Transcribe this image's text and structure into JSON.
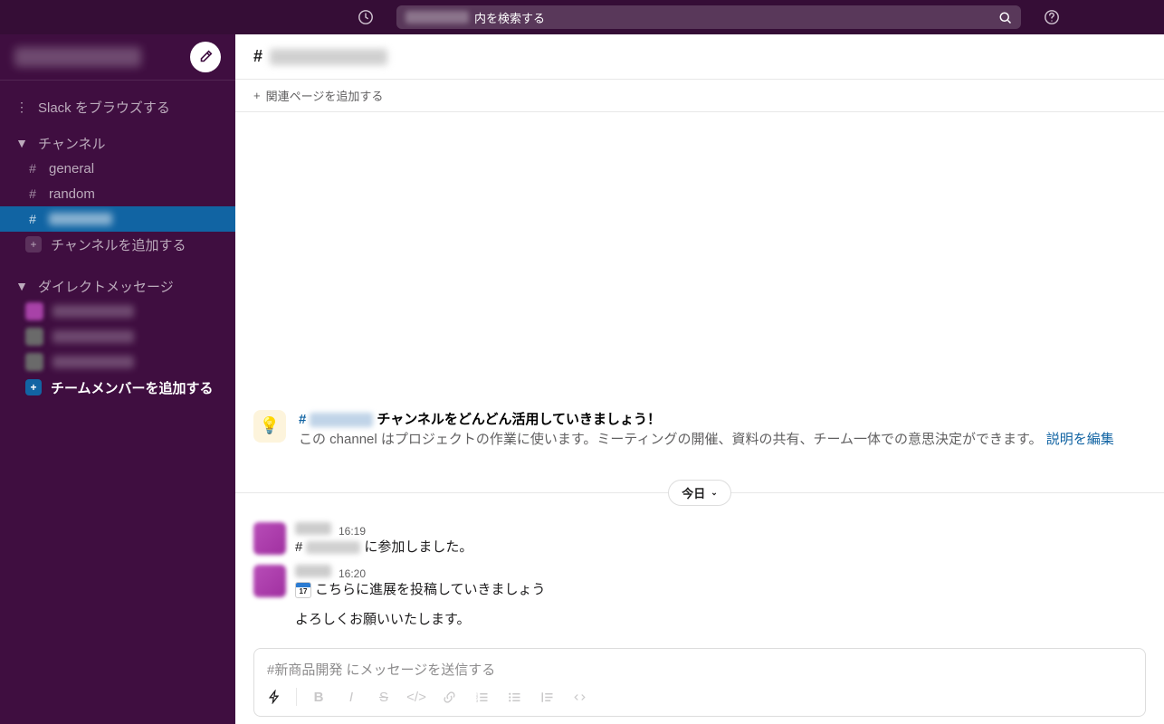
{
  "topbar": {
    "search_suffix": "内を検索する"
  },
  "sidebar": {
    "browse_label": "Slack をブラウズする",
    "channels_header": "チャンネル",
    "channels": [
      "general",
      "random"
    ],
    "add_channel_label": "チャンネルを追加する",
    "dm_header": "ダイレクトメッセージ",
    "add_member_label": "チームメンバーを追加する"
  },
  "content": {
    "add_page_label": "関連ページを追加する",
    "intro_suffix": "チャンネルをどんどん活用していきましょう！",
    "intro_desc_prefix": "この channel はプロジェクトの作業に使います。ミーティングの開催、資料の共有、チーム一体での意思決定ができます。",
    "edit_desc_label": "説明を編集",
    "divider_label": "今日",
    "time1": "16:19",
    "msg1_suffix": "に参加しました。",
    "time2": "16:20",
    "cal_day": "17",
    "msg2_text": "こちらに進展を投稿していきましょう",
    "msg2_line2": "よろしくお願いいたします。",
    "composer_placeholder": "#新商品開発 にメッセージを送信する"
  }
}
